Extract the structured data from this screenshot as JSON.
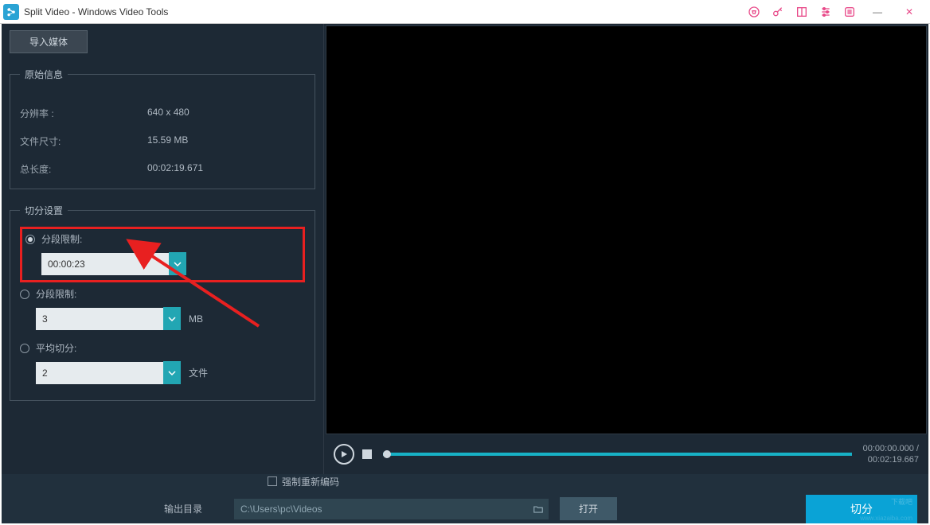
{
  "titlebar": {
    "app_name": "Split Video - Windows Video Tools"
  },
  "left": {
    "import_label": "导入媒体",
    "original_info": {
      "legend": "原始信息",
      "resolution_label": "分辨率 :",
      "resolution_value": "640 x 480",
      "filesize_label": "文件尺寸:",
      "filesize_value": "15.59 MB",
      "duration_label": "总长度:",
      "duration_value": "00:02:19.671"
    },
    "split_settings": {
      "legend": "切分设置",
      "opt1_label": "分段限制:",
      "opt1_value": "00:00:23",
      "opt2_label": "分段限制:",
      "opt2_value": "3",
      "opt2_unit": "MB",
      "opt3_label": "平均切分:",
      "opt3_value": "2",
      "opt3_unit": "文件"
    }
  },
  "player": {
    "current_time": "00:00:00.000",
    "separator": " / ",
    "total_time": "00:02:19.667"
  },
  "bottom": {
    "reencode_label": "强制重新编码",
    "output_label": "输出目录",
    "output_path": "C:\\Users\\pc\\Videos",
    "open_label": "打开",
    "split_label": "切分"
  }
}
